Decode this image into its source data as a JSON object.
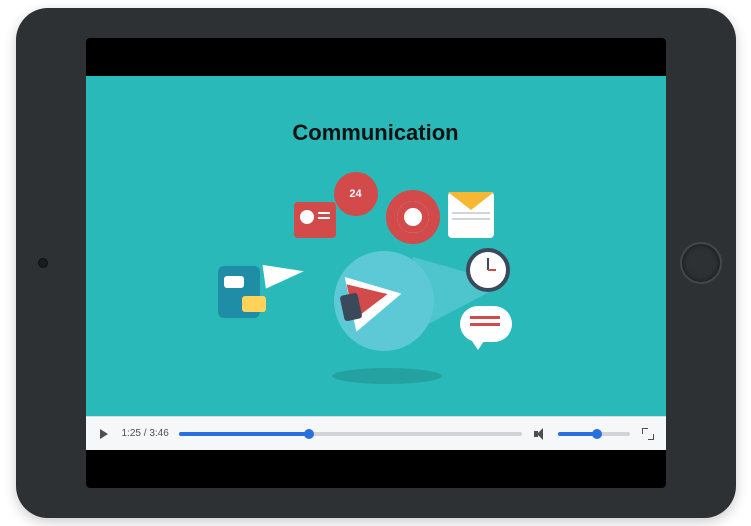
{
  "video": {
    "title": "Communication"
  },
  "player": {
    "current_time": "1:25",
    "duration": "3:46",
    "time_separator": " / ",
    "seek_percent": 38,
    "volume_percent": 55
  },
  "icons": {
    "phone24": "phone-24-icon",
    "target": "target-icon",
    "envelope": "envelope-icon",
    "id_card": "id-card-icon",
    "paper_plane": "paper-plane-icon",
    "chat_app": "chat-app-icon",
    "stopwatch": "stopwatch-icon",
    "speech_bubble": "speech-bubble-icon",
    "megaphone": "megaphone-icon"
  },
  "colors": {
    "video_bg": "#2ab9b9",
    "frame": "#2e3134",
    "accent": "#2a6fe0",
    "red": "#d24a4a"
  }
}
